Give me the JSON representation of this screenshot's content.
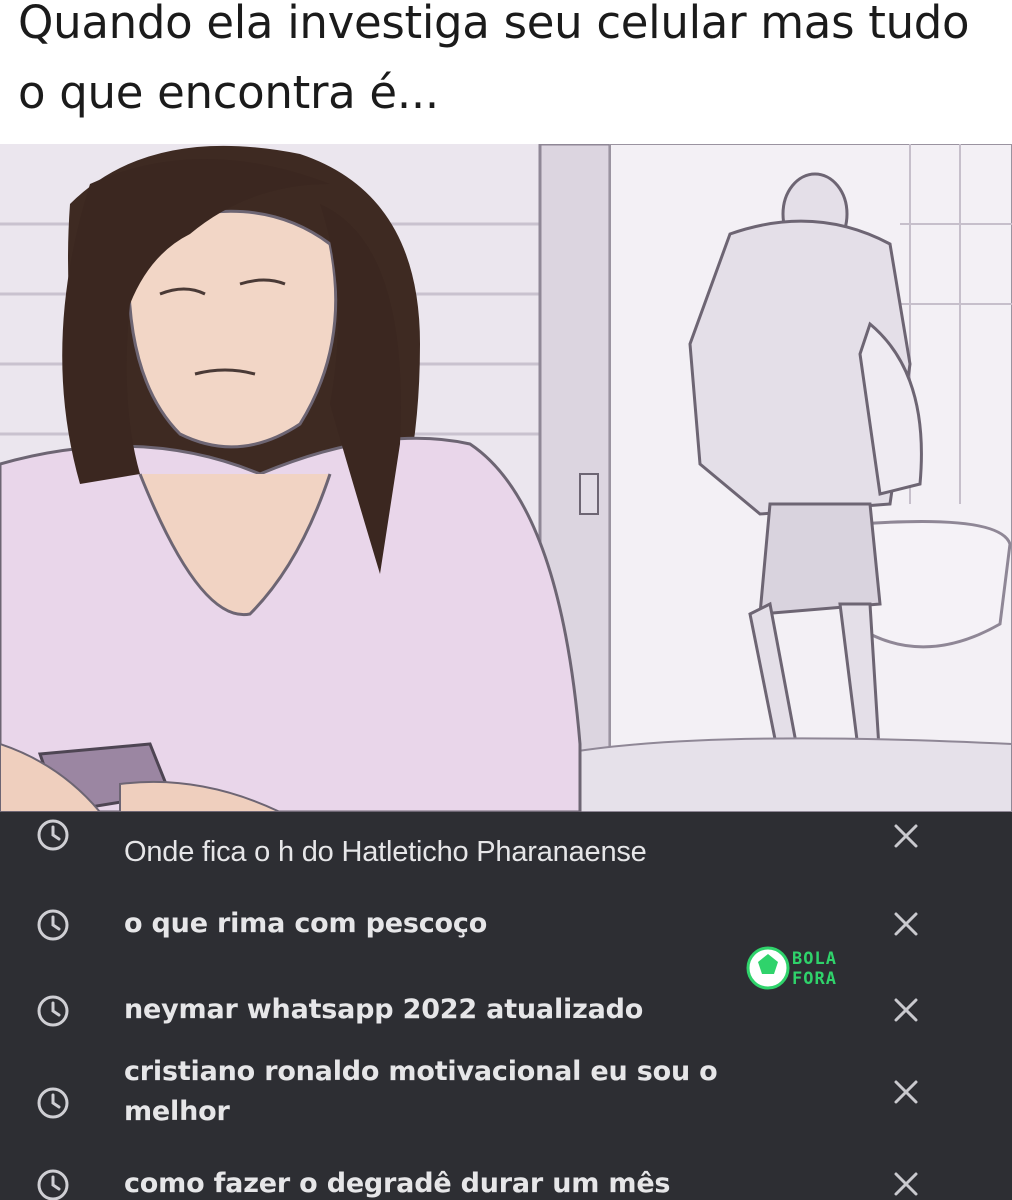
{
  "caption": "Quando ela investiga seu celular mas tudo o que encontra é...",
  "colors": {
    "panel_background": "#2d2e33",
    "panel_text": "#e6e6e8",
    "logo_green": "#2fd36b"
  },
  "logo": {
    "line1": "BOLA",
    "line2": "FORA"
  },
  "history": {
    "items": [
      {
        "text": "Onde fica o h do Hatleticho Pharanaense",
        "icon": "clock-icon",
        "action_icon": "close-icon"
      },
      {
        "text": "o que rima com pescoço",
        "icon": "clock-icon",
        "action_icon": "close-icon"
      },
      {
        "text": "neymar whatsapp 2022 atualizado",
        "icon": "clock-icon",
        "action_icon": "close-icon"
      },
      {
        "text": "cristiano ronaldo motivacional eu sou o melhor",
        "icon": "clock-icon",
        "action_icon": "close-icon"
      },
      {
        "text": "como fazer o degradê durar um mês",
        "icon": "clock-icon",
        "action_icon": "close-icon"
      }
    ]
  }
}
